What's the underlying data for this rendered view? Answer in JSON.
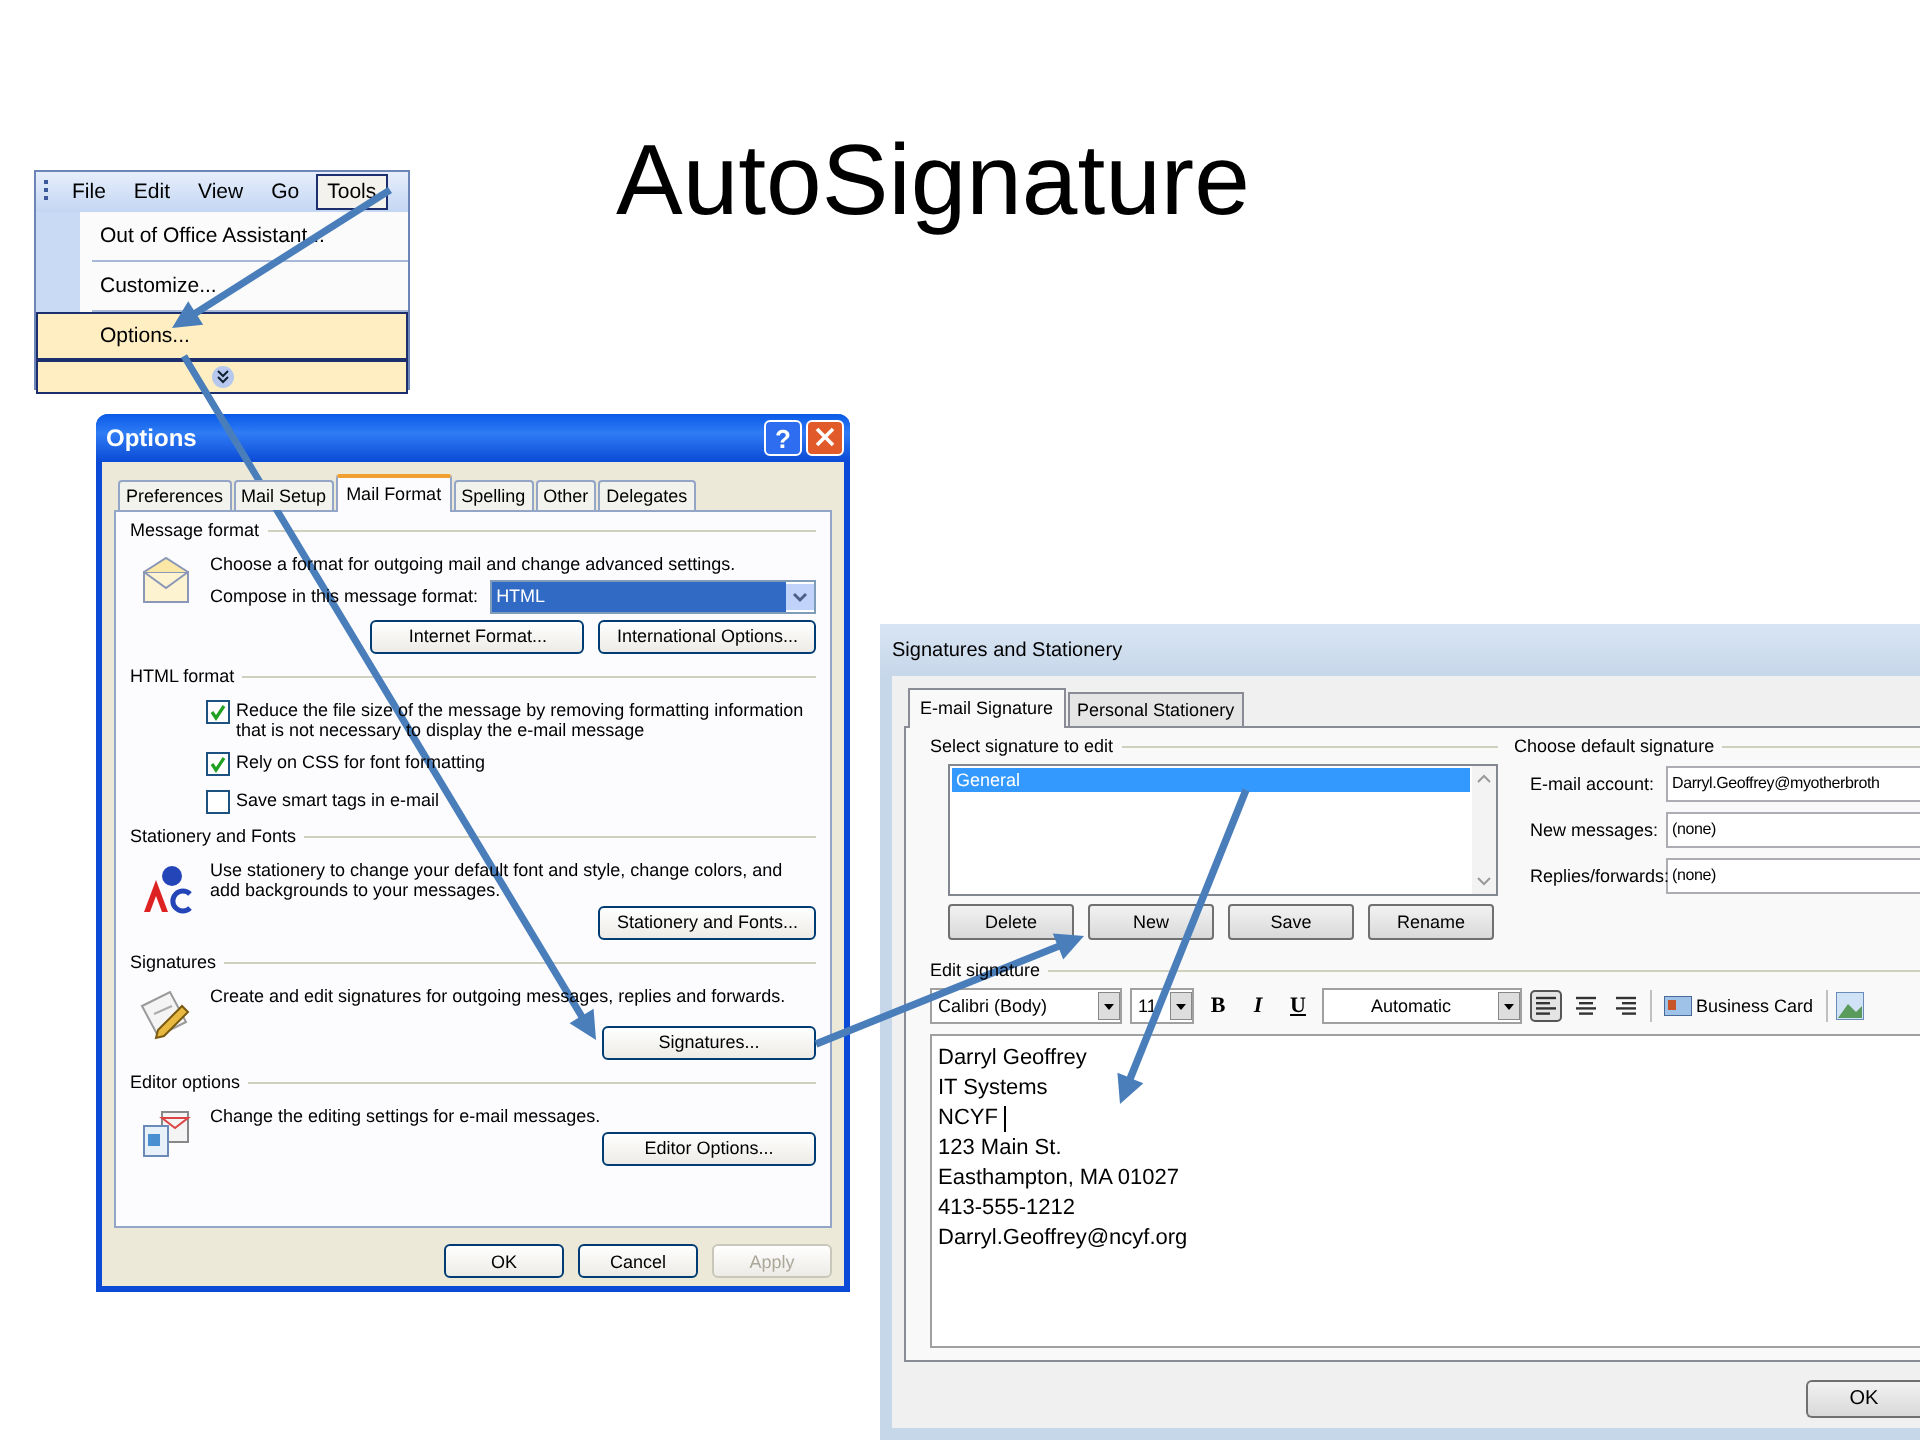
{
  "slide_title": "AutoSignature",
  "menu": {
    "menubar": [
      {
        "label": "File",
        "selected": false
      },
      {
        "label": "Edit",
        "selected": false
      },
      {
        "label": "View",
        "selected": false
      },
      {
        "label": "Go",
        "selected": false
      },
      {
        "label": "Tools",
        "selected": true
      }
    ],
    "items": [
      {
        "label": "Out of Office Assistant...",
        "selected": false
      },
      {
        "label": "Customize...",
        "selected": false
      },
      {
        "label": "Options...",
        "selected": true
      }
    ]
  },
  "options_dialog": {
    "title": "Options",
    "help": "?",
    "tabs": [
      {
        "label": "Preferences",
        "selected": false
      },
      {
        "label": "Mail Setup",
        "selected": false
      },
      {
        "label": "Mail Format",
        "selected": true
      },
      {
        "label": "Spelling",
        "selected": false
      },
      {
        "label": "Other",
        "selected": false
      },
      {
        "label": "Delegates",
        "selected": false
      }
    ],
    "sections": [
      {
        "kind": "message",
        "heading": "Message format",
        "description": "Choose a format for outgoing mail and change advanced settings.",
        "compose_label": "Compose in this message format:",
        "compose_value": "HTML",
        "buttons": [
          "Internet Format...",
          "International Options..."
        ]
      },
      {
        "kind": "html",
        "heading": "HTML format",
        "options": [
          {
            "label": "Reduce the file size of the message by removing formatting information that is not necessary to display the e-mail message",
            "checked": true
          },
          {
            "label": "Rely on CSS for font formatting",
            "checked": true
          },
          {
            "label": "Save smart tags in e-mail",
            "checked": false
          }
        ]
      },
      {
        "kind": "stationery",
        "heading": "Stationery and Fonts",
        "description": "Use stationery to change your default font and style, change colors, and add backgrounds to your messages.",
        "buttons": [
          "Stationery and Fonts..."
        ]
      },
      {
        "kind": "signatures",
        "heading": "Signatures",
        "description": "Create and edit signatures for outgoing messages, replies and forwards.",
        "buttons": [
          "Signatures..."
        ]
      },
      {
        "kind": "editor",
        "heading": "Editor options",
        "description": "Change the editing settings for e-mail messages.",
        "buttons": [
          "Editor Options..."
        ]
      }
    ],
    "footer_buttons": [
      {
        "label": "OK",
        "disabled": false
      },
      {
        "label": "Cancel",
        "disabled": false
      },
      {
        "label": "Apply",
        "disabled": true
      }
    ]
  },
  "signatures_dialog": {
    "title": "Signatures and Stationery",
    "tabs": [
      {
        "label": "E-mail Signature",
        "selected": true
      },
      {
        "label": "Personal Stationery",
        "selected": false
      }
    ],
    "select_heading": "Select signature to edit",
    "signatures": [
      {
        "label": "General",
        "selected": true
      }
    ],
    "list_buttons": [
      "Delete",
      "New",
      "Save",
      "Rename"
    ],
    "default_heading": "Choose default signature",
    "fields": [
      {
        "label": "E-mail account:",
        "value": "Darryl.Geoffrey@myotherbroth"
      },
      {
        "label": "New messages:",
        "value": "(none)"
      },
      {
        "label": "Replies/forwards:",
        "value": "(none)"
      }
    ],
    "edit_heading": "Edit signature",
    "toolbar": {
      "font": "Calibri (Body)",
      "size": "11",
      "format_buttons": [
        "B",
        "I",
        "U"
      ],
      "font_color_label": "Automatic",
      "alignments": [
        {
          "selected": true
        },
        {
          "selected": false
        },
        {
          "selected": false
        }
      ],
      "business_card": "Business Card"
    },
    "signature_lines": [
      "Darryl Geoffrey",
      "IT Systems",
      "NCYF",
      "123 Main St.",
      "Easthampton, MA 01027",
      "413-555-1212",
      "Darryl.Geoffrey@ncyf.org"
    ],
    "ok": "OK"
  }
}
